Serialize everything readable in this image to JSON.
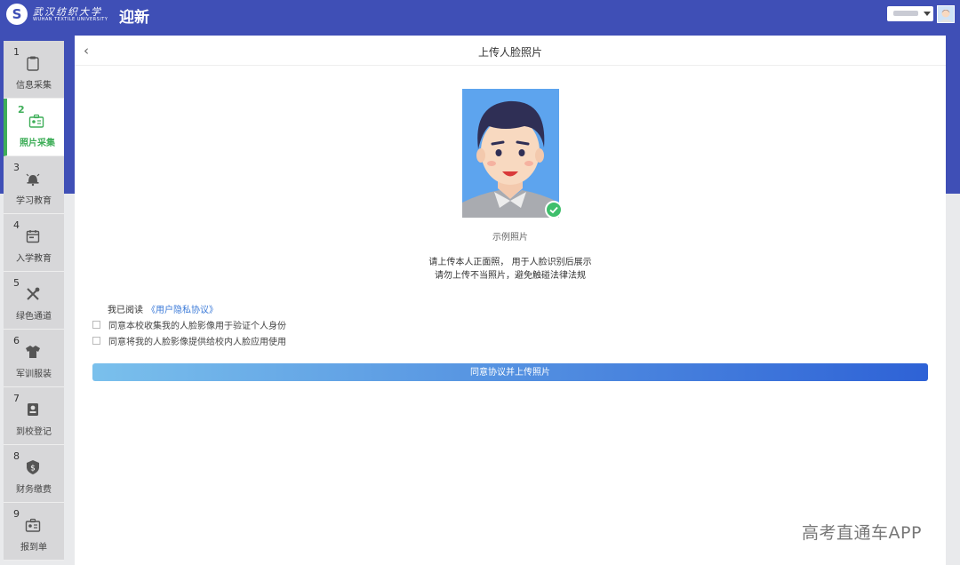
{
  "header": {
    "logo_cn": "武汉纺织大学",
    "logo_en": "WUHAN TEXTILE UNIVERSITY",
    "app_title": "迎新",
    "logo_badge": "S"
  },
  "sidebar": {
    "items": [
      {
        "num": "1",
        "label": "信息采集",
        "icon": "clipboard-icon"
      },
      {
        "num": "2",
        "label": "照片采集",
        "icon": "id-card-icon",
        "active": true
      },
      {
        "num": "3",
        "label": "学习教育",
        "icon": "bell-icon"
      },
      {
        "num": "4",
        "label": "入学教育",
        "icon": "calendar-icon"
      },
      {
        "num": "5",
        "label": "绿色通道",
        "icon": "tools-icon"
      },
      {
        "num": "6",
        "label": "军训服装",
        "icon": "shirt-icon"
      },
      {
        "num": "7",
        "label": "到校登记",
        "icon": "badge-icon"
      },
      {
        "num": "8",
        "label": "财务缴费",
        "icon": "shield-money-icon"
      },
      {
        "num": "9",
        "label": "报到单",
        "icon": "card-icon"
      }
    ]
  },
  "main": {
    "back_icon": "‹",
    "title": "上传人脸照片",
    "photo_caption": "示例照片",
    "notice_line1": "请上传本人正面照， 用于人脸识别后展示",
    "notice_line2": "请勿上传不当照片，避免触碰法律法规",
    "agree_prefix": "我已阅读",
    "agree_link": "《用户隐私协议》",
    "consent1": "同意本校收集我的人脸影像用于验证个人身份",
    "consent2": "同意将我的人脸影像提供给校内人脸应用使用",
    "submit_label": "同意协议并上传照片"
  },
  "watermark": "高考直通车APP",
  "colors": {
    "brand": "#3f4fb6",
    "active": "#3fae59",
    "link": "#3b7ad8",
    "photo_bg": "#5da4ee"
  }
}
